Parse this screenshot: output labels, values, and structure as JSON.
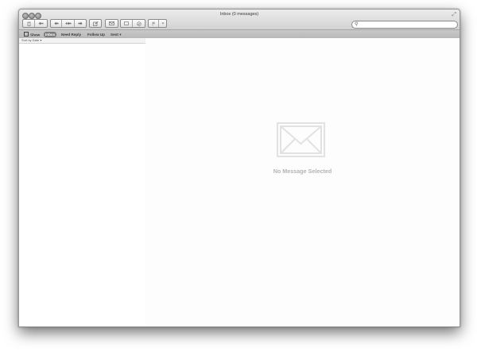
{
  "window": {
    "title": "Inbox (0 messages)"
  },
  "toolbar": {
    "groups": [
      {
        "icons": [
          "trash-icon",
          "junk-icon"
        ]
      },
      {
        "icons": [
          "reply-icon",
          "reply-all-icon",
          "forward-icon"
        ]
      },
      {
        "icons": [
          "compose-icon"
        ]
      },
      {
        "icons": [
          "get-mail-icon"
        ]
      },
      {
        "icons": [
          "note-icon",
          "todo-icon"
        ]
      },
      {
        "icons": [
          "flag-icon",
          "flag-menu-icon"
        ]
      }
    ]
  },
  "search": {
    "placeholder": ""
  },
  "favorites": {
    "show_label": "Show",
    "items": [
      {
        "label": "Inbox",
        "selected": true
      },
      {
        "label": "Need Reply",
        "selected": false
      },
      {
        "label": "Follow Up",
        "selected": false
      },
      {
        "label": "Sent ▾",
        "selected": false
      }
    ]
  },
  "message_list": {
    "sort_label": "Sort by Date ▾"
  },
  "preview": {
    "empty_text": "No Message Selected"
  }
}
